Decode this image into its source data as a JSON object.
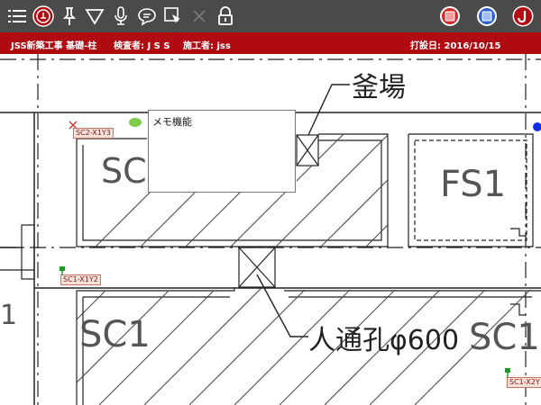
{
  "toolbar": {
    "icons": [
      "list-icon",
      "question-circle-icon",
      "pin-icon",
      "triangle-icon",
      "microphone-icon",
      "speech-bubble-icon",
      "cursor-select-icon",
      "close-icon",
      "lock-icon",
      "stamp-red-icon",
      "stamp-blue-icon",
      "app-logo-icon"
    ]
  },
  "info": {
    "title": "JSS新築工事 基礎-柱",
    "inspector": "検査者: J S S",
    "contractor": "施工者: jss",
    "pour_date": "打設日: 2016/10/15"
  },
  "drawing": {
    "labels": {
      "kamaba": "釜場",
      "sc1_top": "SC1",
      "fs1": "FS1",
      "sc1_bottom": "SC1",
      "sc1_right": "SC1",
      "manhole": "人通孔φ600",
      "edge_1": "1"
    }
  },
  "markers": [
    {
      "label": "SC2-X1Y3"
    },
    {
      "label": "SC1-X1Y2"
    },
    {
      "label": "SC1-X2Y"
    }
  ],
  "memo": {
    "label": "メモ機能"
  },
  "colors": {
    "toolbar": "#4a4a4a",
    "infobar": "#b00b12",
    "marker_green": "#1a9a2a",
    "marker_blue": "#1030e0"
  }
}
